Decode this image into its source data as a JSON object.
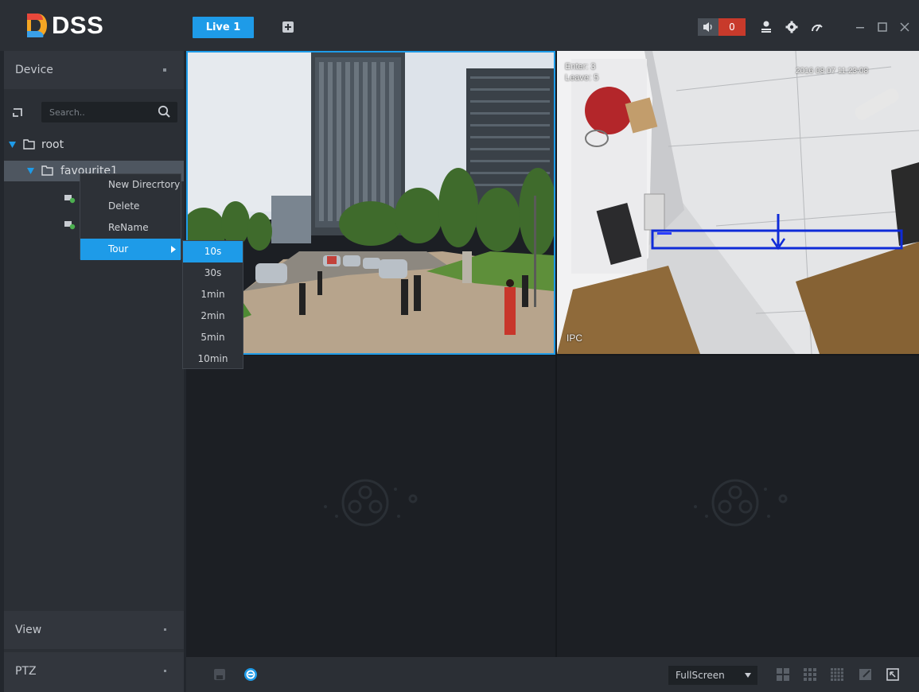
{
  "app": {
    "name": "DSS"
  },
  "tabs": [
    {
      "label": "Live 1"
    }
  ],
  "header": {
    "alarm_count": "0"
  },
  "sidebar": {
    "device_label": "Device",
    "view_label": "View",
    "ptz_label": "PTZ",
    "search_placeholder": "Search..",
    "tree": [
      {
        "label": "root",
        "level": 0
      },
      {
        "label": "favourite1",
        "level": 1
      }
    ]
  },
  "context_menu": {
    "items": [
      "New Direcrtory",
      "Delete",
      "ReName",
      "Tour"
    ],
    "tour_options": [
      "10s",
      "30s",
      "1min",
      "2min",
      "5min",
      "10min"
    ]
  },
  "video": {
    "cell2": {
      "enter": "Enter: 3",
      "leave": "Leave: 5",
      "timestamp": "2016 08 07 11:23:08",
      "channel": "IPC"
    }
  },
  "bottom": {
    "fullscreen_label": "FullScreen"
  },
  "colors": {
    "accent": "#1e9be8",
    "alarm": "#c83a2b"
  }
}
